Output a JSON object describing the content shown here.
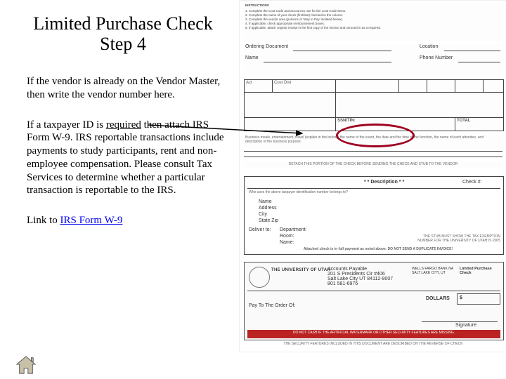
{
  "title_line1": "Limited Purchase Check",
  "title_line2": "Step 4",
  "para1": "If the vendor is already on the Vendor Master, then write the vendor number here.",
  "para2_a": "If a taxpayer ID is ",
  "para2_required": "required",
  "para2_b": " then attach IRS Form W-9.  IRS reportable transactions include payments to study participants, rent and non-employee compensation. Please consult Tax Services to determine whether a particular transaction is reportable to the IRS.",
  "link_prefix": "Link to ",
  "link_text": "IRS Form W-9",
  "form": {
    "instr_label": "INSTRUCTIONS",
    "instr1": "1. Complete the Cost Code and account to use for the Cost Code items.",
    "instr2": "2. Complete the name of your check (first/last) checked in the column.",
    "instr3": "3. Complete the vendor area (portions of 'Way to Pay' isolated below).",
    "instr4": "4. If applicable, check appropriate reimbursement boxes.",
    "instr5": "5. If applicable, attach original receipt in the first copy of the invoice and xeroxed in as a required.",
    "ordering_doc": "Ordering Document",
    "location": "Location",
    "name": "Name",
    "phone": "Phone Number",
    "col_act": "Act",
    "col_cost": "Cost Dist",
    "col_blank": "",
    "ssn_label": "SSN/TIN:",
    "total_label": "TOTAL",
    "desc_note": "Business meals, entertainment, travel (explain in the below): the name of the event, the date and the time of the function, the name of each attendee, and description of the business purpose.",
    "detach": "DETACH THIS PORTION OF THE CHECK BEFORE SENDING THE CHECK AND STUB TO THE VENDOR",
    "desc_hdr": "* * Description * *",
    "check_no": "Check #:",
    "who_uses": "Who uses the above taxpayer identification number belongs to?",
    "addr_name": "Name",
    "addr_addr": "Address",
    "addr_city": "City",
    "addr_sz": "State Zip",
    "deliver": "Deliver to:",
    "dept": "Department:",
    "room": "Room:",
    "pname": "Name:",
    "fax_note": "THE STUB MUST SHOW THE TAX EXEMPTION NUMBER FOR THE UNIVERSITY OF UTAH IS 2005",
    "full_pay": "Attached check is in full payment as noted above. DO NOT SEND A DUPLICATE INVOICE!",
    "univ": "THE UNIVERSITY OF UTAH",
    "ap": "Accounts Payable",
    "ap_addr1": "201 S Presidents Cir #406",
    "ap_addr2": "Salt Lake City UT 84112-9007",
    "ap_ph": "801 581-6976",
    "bank": "WELLS FARGO BANK NA",
    "bank_city": "SALT LAKE CITY, UT",
    "lpc": "Limited Purchase Check",
    "payto": "Pay To The Order Of:",
    "dollars": "DOLLARS",
    "dollar_sign": "$",
    "sig": "Signature",
    "warn": "DO NOT CASH IF THE ARTIFICIAL WATERMARK OR OTHER SECURITY FEATURES ARE MISSING.",
    "warn2": "THE SECURITY FEATURES INCLUDED IN THIS DOCUMENT ARE DESCRIBED ON THE REVERSE OF CHECK"
  }
}
